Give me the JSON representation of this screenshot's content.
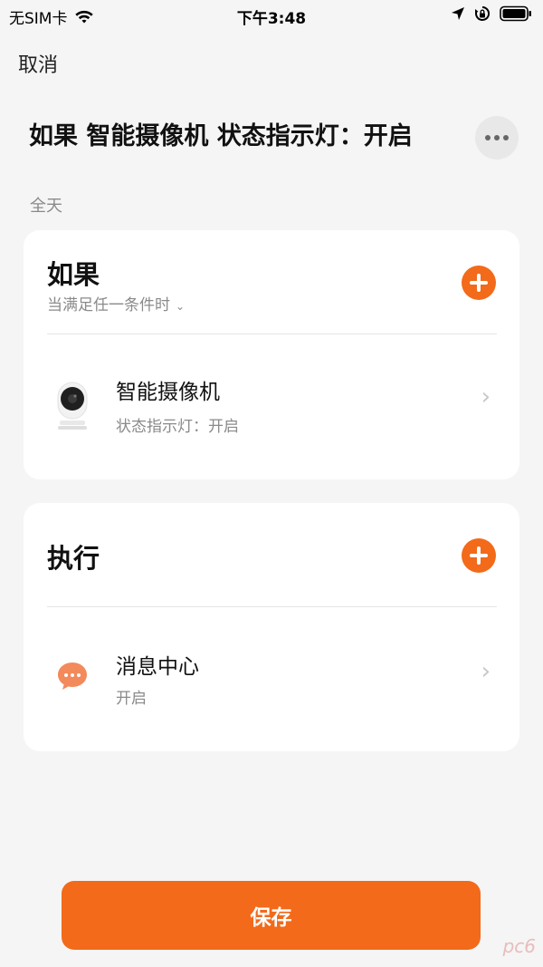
{
  "status_bar": {
    "carrier": "无SIM卡",
    "time": "下午3:48",
    "icons": [
      "wifi-icon",
      "location-icon",
      "rotation-lock-icon",
      "battery-icon"
    ]
  },
  "top": {
    "cancel": "取消"
  },
  "rule": {
    "title": "如果 智能摄像机 状态指示灯：开启",
    "subtitle": "全天",
    "more_icon": "more-icon"
  },
  "if_section": {
    "title": "如果",
    "condition_mode": "当满足任一条件时",
    "add_icon": "add-icon",
    "items": [
      {
        "icon": "camera-device-icon",
        "name": "智能摄像机",
        "detail": "状态指示灯：开启",
        "chevron": "›"
      }
    ]
  },
  "do_section": {
    "title": "执行",
    "add_icon": "add-icon",
    "items": [
      {
        "icon": "message-center-icon",
        "name": "消息中心",
        "detail": "开启",
        "chevron": "›"
      }
    ]
  },
  "save": "保存",
  "watermark": "pc6",
  "colors": {
    "accent": "#f26a1a",
    "background": "#f5f5f5",
    "card": "#ffffff",
    "secondary_text": "#8a8a8a"
  }
}
